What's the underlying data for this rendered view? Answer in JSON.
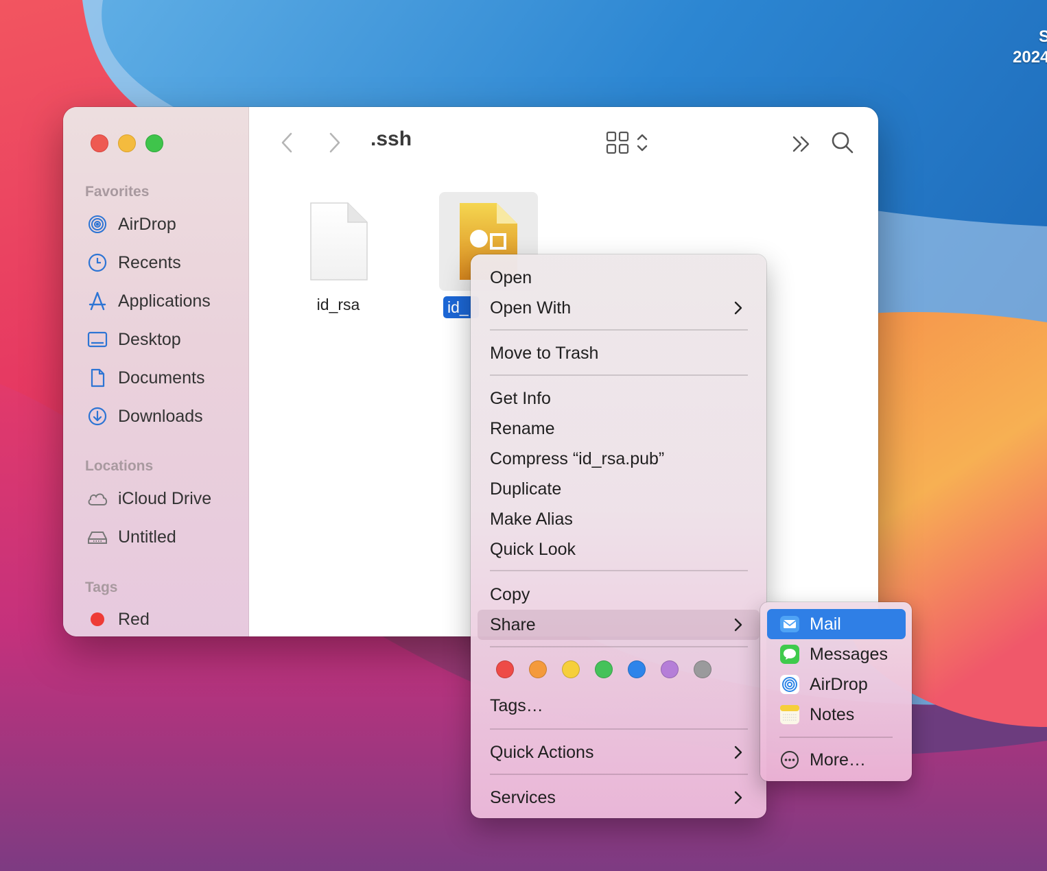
{
  "desktop": {
    "clock_line1": "S",
    "clock_line2": "2024"
  },
  "window": {
    "title": ".ssh",
    "sidebar": {
      "favorites_header": "Favorites",
      "favorites": [
        {
          "label": "AirDrop",
          "icon": "airdrop-icon"
        },
        {
          "label": "Recents",
          "icon": "clock-icon"
        },
        {
          "label": "Applications",
          "icon": "applications-icon"
        },
        {
          "label": "Desktop",
          "icon": "desktop-icon"
        },
        {
          "label": "Documents",
          "icon": "document-icon"
        },
        {
          "label": "Downloads",
          "icon": "download-icon"
        }
      ],
      "locations_header": "Locations",
      "locations": [
        {
          "label": "iCloud Drive",
          "icon": "cloud-icon"
        },
        {
          "label": "Untitled",
          "icon": "disk-icon"
        }
      ],
      "tags_header": "Tags",
      "tags": [
        {
          "label": "Red",
          "color": "#ee3b36"
        }
      ]
    },
    "files": [
      {
        "name": "id_rsa",
        "selected": false
      },
      {
        "name": "id_",
        "selected": true
      }
    ]
  },
  "context_menu": {
    "items": {
      "open": "Open",
      "open_with": "Open With",
      "move_to_trash": "Move to Trash",
      "get_info": "Get Info",
      "rename": "Rename",
      "compress": "Compress “id_rsa.pub”",
      "duplicate": "Duplicate",
      "make_alias": "Make Alias",
      "quick_look": "Quick Look",
      "copy": "Copy",
      "share": "Share",
      "tags": "Tags…",
      "quick_actions": "Quick Actions",
      "services": "Services"
    },
    "tag_colors": [
      "#ee4b47",
      "#f49a3c",
      "#f6cf3b",
      "#45c25a",
      "#2e84ea",
      "#b57ed8",
      "#9a9a9c"
    ]
  },
  "share_menu": {
    "items": [
      {
        "label": "Mail",
        "icon": "mail-icon",
        "selected": true
      },
      {
        "label": "Messages",
        "icon": "messages-icon",
        "selected": false
      },
      {
        "label": "AirDrop",
        "icon": "airdrop-icon",
        "selected": false
      },
      {
        "label": "Notes",
        "icon": "notes-icon",
        "selected": false
      }
    ],
    "more": "More…"
  }
}
